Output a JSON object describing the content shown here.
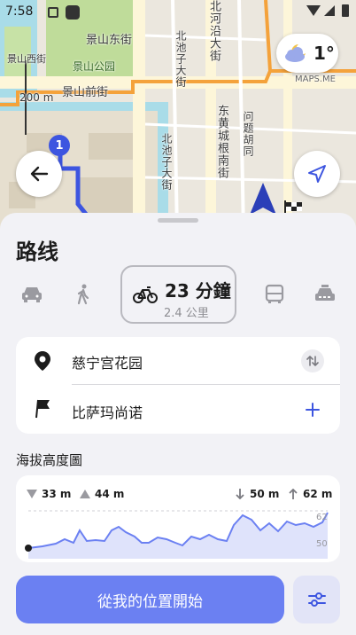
{
  "status_bar": {
    "time": "7:58"
  },
  "map": {
    "labels": {
      "park": "景山公园",
      "park_west": "景山西街",
      "park_east": "景山东街",
      "jingshan_front": "景山前街",
      "scale": "200 m",
      "beiheyan": "北河沿大街",
      "beichizi_top": "北池子大街",
      "beichizi": "北池子大街",
      "donghuangcheng": "东黄城根南街",
      "yanyue": "问题胡同",
      "maps_me": "MAPS.ME",
      "waypoint": "1"
    },
    "weather": {
      "icon": "night-cloud-icon",
      "temp": "1°"
    }
  },
  "sheet": {
    "title": "路线",
    "modes": [
      {
        "name": "car",
        "icon": "car-icon"
      },
      {
        "name": "walk",
        "icon": "walk-icon"
      },
      {
        "name": "bicycle",
        "icon": "bicycle-icon",
        "selected": true,
        "time": "23 分鐘",
        "distance": "2.4 公里"
      },
      {
        "name": "transit",
        "icon": "bus-icon"
      },
      {
        "name": "taxi",
        "icon": "taxi-icon"
      }
    ],
    "start_point": "慈宁宫花园",
    "end_point": "比萨玛尚诺",
    "elevation": {
      "title": "海拔高度圖",
      "min": "33 m",
      "max": "44 m",
      "descent": "50 m",
      "ascent": "62 m",
      "axis_high": "62",
      "axis_low": "50"
    },
    "start_button": "從我的位置開始"
  },
  "colors": {
    "accent": "#6b80f2",
    "route": "#3d55e0"
  }
}
